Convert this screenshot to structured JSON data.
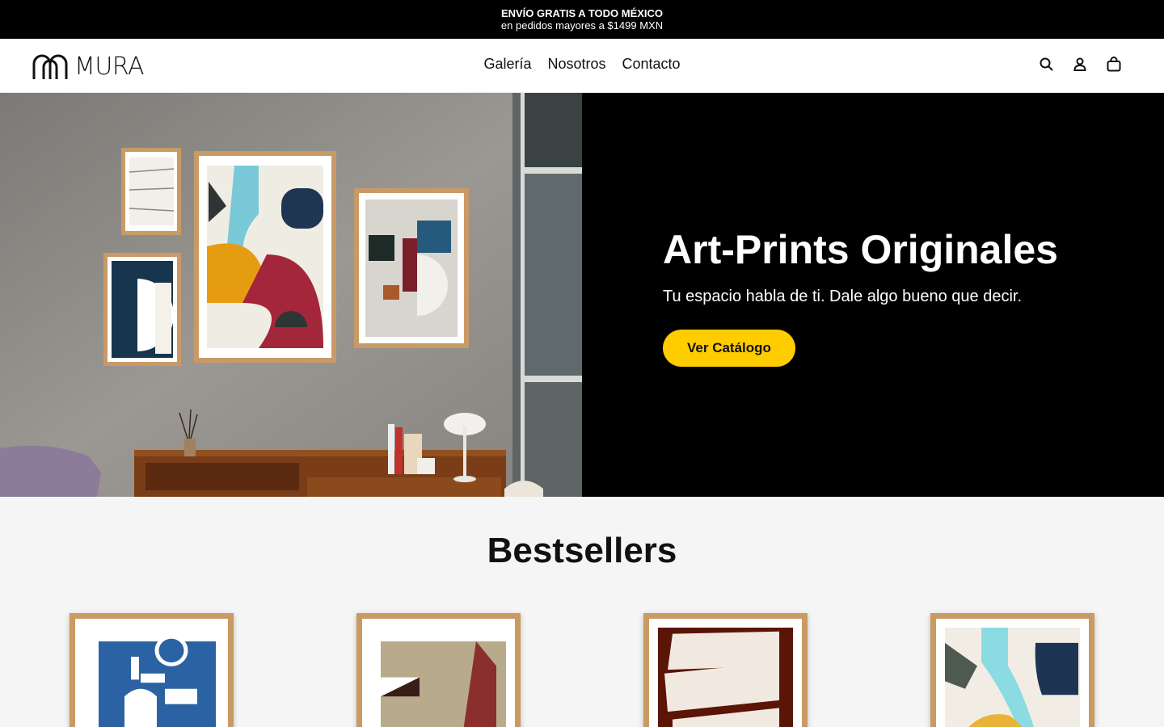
{
  "announcement": {
    "line1": "ENVÍO GRATIS A TODO MÉXICO",
    "line2": "en pedidos mayores a $1499 MXN"
  },
  "header": {
    "logo_text": "MURA",
    "nav": [
      "Galería",
      "Nosotros",
      "Contacto"
    ],
    "icons": [
      "search-icon",
      "account-icon",
      "cart-icon"
    ]
  },
  "hero": {
    "title": "Art-Prints Originales",
    "subtitle": "Tu espacio habla de ti. Dale algo bueno que decir.",
    "cta_label": "Ver Catálogo"
  },
  "bestsellers": {
    "heading": "Bestsellers"
  },
  "colors": {
    "accent": "#ffcc00",
    "hero_bg": "#000000",
    "announcement_bg": "#000000"
  }
}
